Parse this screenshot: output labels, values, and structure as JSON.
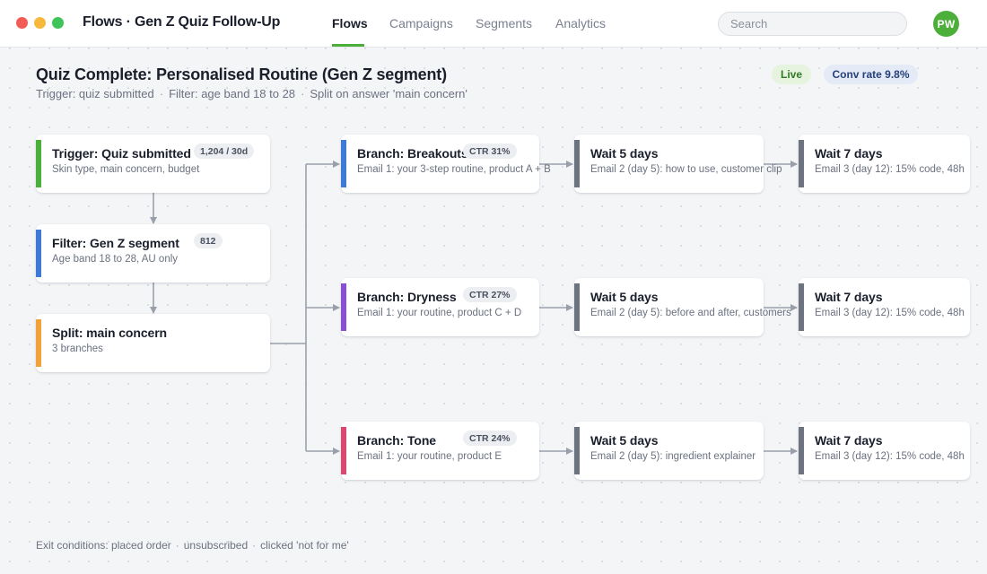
{
  "header": {
    "app_title": "Flows · Gen Z Quiz Follow-Up",
    "tabs": [
      {
        "label": "Flows",
        "active": true
      },
      {
        "label": "Campaigns",
        "active": false
      },
      {
        "label": "Segments",
        "active": false
      },
      {
        "label": "Analytics",
        "active": false
      }
    ],
    "search_placeholder": "Search",
    "avatar_initials": "PW"
  },
  "flow": {
    "title": "Quiz Complete: Personalised Routine (Gen Z segment)",
    "trigger": "Trigger: quiz submitted",
    "filter": "Filter: age band 18 to 28",
    "split": "Split on answer 'main concern'",
    "status": "Live",
    "conv_rate": "Conv rate 9.8%"
  },
  "nodes": {
    "trigger": {
      "title": "Trigger: Quiz submitted",
      "sub": "Skin type, main concern, budget",
      "badge": "1,204 / 30d"
    },
    "filter": {
      "title": "Filter: Gen Z segment",
      "sub": "Age band 18 to 28, AU only",
      "badge": "812"
    },
    "split": {
      "title": "Split: main concern",
      "sub": "3 branches"
    }
  },
  "branches": [
    {
      "title": "Branch: Breakouts",
      "badge": "CTR 31%",
      "sub": "Email 1: your 3-step routine, product A + B",
      "wait1_title": "Wait 5 days",
      "wait1_sub": "Email 2 (day 5): how to use, customer clip",
      "wait2_title": "Wait 7 days",
      "wait2_sub": "Email 3 (day 12): 15% code, 48h"
    },
    {
      "title": "Branch: Dryness",
      "badge": "CTR 27%",
      "sub": "Email 1: your routine, product C + D",
      "wait1_title": "Wait 5 days",
      "wait1_sub": "Email 2 (day 5): before and after, customers",
      "wait2_title": "Wait 7 days",
      "wait2_sub": "Email 3 (day 12): 15% code, 48h"
    },
    {
      "title": "Branch: Tone",
      "badge": "CTR 24%",
      "sub": "Email 1: your routine, product E",
      "wait1_title": "Wait 5 days",
      "wait1_sub": "Email 2 (day 5): ingredient explainer",
      "wait2_title": "Wait 7 days",
      "wait2_sub": "Email 3 (day 12): 15% code, 48h"
    }
  ],
  "exit_conditions": {
    "label": "Exit conditions: placed order",
    "item2": "unsubscribed",
    "item3": "clicked 'not for me'"
  },
  "colors": {
    "trigger": "#4caf3a",
    "filter": "#3f7bd6",
    "split": "#f2a23a",
    "breakouts": "#3f7bd6",
    "dryness": "#8b4fd1",
    "tone": "#d9486f",
    "wait": "#6d7380"
  }
}
